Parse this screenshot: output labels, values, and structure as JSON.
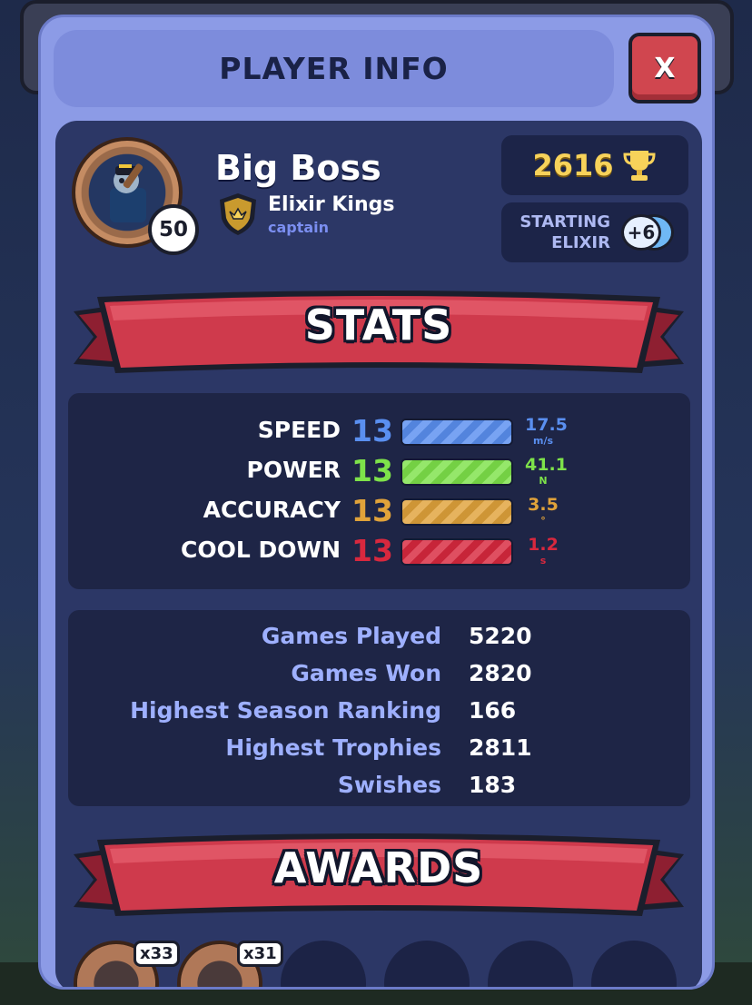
{
  "title": "PLAYER INFO",
  "close_label": "X",
  "player": {
    "name": "Big Boss",
    "level": "50",
    "clan_name": "Elixir Kings",
    "clan_role": "captain"
  },
  "trophies": "2616",
  "starting_elixir": {
    "label_line1": "STARTING",
    "label_line2": "ELIXIR",
    "value": "+6"
  },
  "sections": {
    "stats": "STATS",
    "awards": "AWARDS"
  },
  "stats": [
    {
      "label": "SPEED",
      "level": "13",
      "value": "17.5",
      "unit": "m/s",
      "color": "#5a8ff0",
      "fill": 1.0
    },
    {
      "label": "POWER",
      "level": "13",
      "value": "41.1",
      "unit": "N",
      "color": "#7ee24a",
      "fill": 1.0
    },
    {
      "label": "ACCURACY",
      "level": "13",
      "value": "3.5",
      "unit": "°",
      "color": "#e0a23a",
      "fill": 1.0
    },
    {
      "label": "COOL DOWN",
      "level": "13",
      "value": "1.2",
      "unit": "s",
      "color": "#d8283e",
      "fill": 1.0
    }
  ],
  "records": [
    {
      "label": "Games Played",
      "value": "5220"
    },
    {
      "label": "Games Won",
      "value": "2820"
    },
    {
      "label": "Highest Season Ranking",
      "value": "166"
    },
    {
      "label": "Highest Trophies",
      "value": "2811"
    },
    {
      "label": "Swishes",
      "value": "183"
    }
  ],
  "awards": [
    {
      "count": "x33",
      "earned": true
    },
    {
      "count": "x31",
      "earned": true
    },
    {
      "count": "",
      "earned": false
    },
    {
      "count": "",
      "earned": false
    },
    {
      "count": "",
      "earned": false
    },
    {
      "count": "",
      "earned": false
    }
  ],
  "colors": {
    "modal": "#8c9be6",
    "panel": "#2c3766",
    "ribbon": "#cf3a4c",
    "trophy_gold": "#f7d25a"
  }
}
